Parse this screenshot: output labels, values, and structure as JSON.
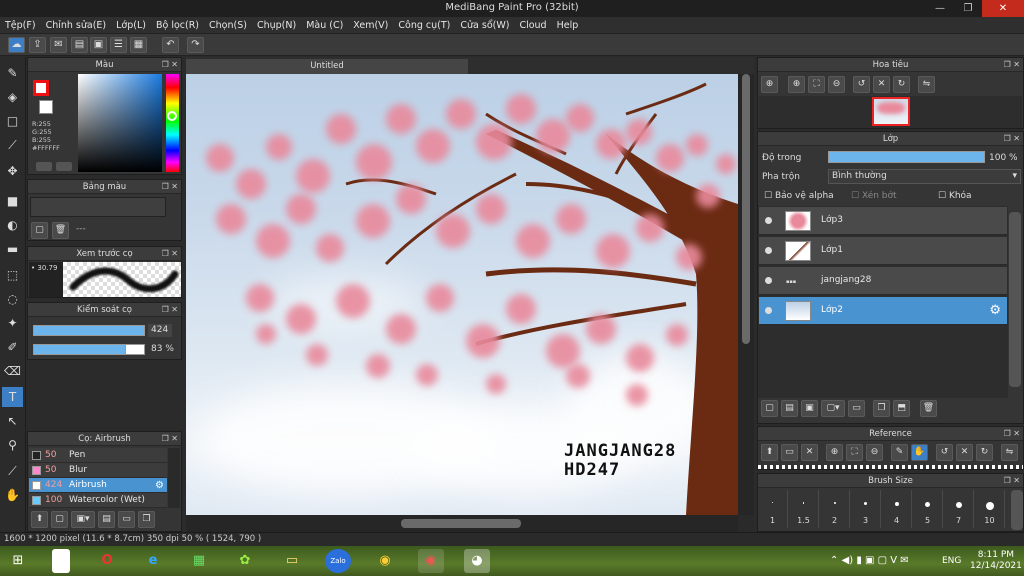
{
  "window": {
    "title": "MediBang Paint Pro (32bit)",
    "minimize": "—",
    "restore": "❐",
    "close": "✕"
  },
  "menu": [
    "Tệp(F)",
    "Chỉnh sửa(E)",
    "Lớp(L)",
    "Bộ lọc(R)",
    "Chọn(S)",
    "Chụp(N)",
    "Màu (C)",
    "Xem(V)",
    "Công cụ(T)",
    "Cửa sổ(W)",
    "Cloud",
    "Help"
  ],
  "panels": {
    "color": {
      "title": "Màu",
      "r": "R:255",
      "g": "G:255",
      "b": "B:255",
      "hex": "#FFFFFF"
    },
    "palette": {
      "title": "Bảng màu",
      "dash": "---"
    },
    "preview": {
      "title": "Xem trước cọ",
      "size": "30.79"
    },
    "control": {
      "title": "Kiểm soát cọ",
      "size": "424",
      "opacity": "83 %",
      "size_fraction": 1.0,
      "opacity_fraction": 0.83
    },
    "brush": {
      "title": "Cọ: Airbrush",
      "items": [
        {
          "size": "50",
          "name": "Pen",
          "color": "#222222"
        },
        {
          "size": "50",
          "name": "Blur",
          "color": "#ff88cc"
        },
        {
          "size": "424",
          "name": "Airbrush",
          "color": "#ffffff",
          "selected": true
        },
        {
          "size": "100",
          "name": "Watercolor (Wet)",
          "color": "#66ccff"
        }
      ]
    },
    "navigator": {
      "title": "Hoa tiêu"
    },
    "layer": {
      "title": "Lớp",
      "opacity_label": "Độ trong",
      "opacity_value": "100 %",
      "blend_label": "Pha trộn",
      "blend_value": "Bình thường",
      "protect_alpha": "Bảo vệ alpha",
      "clipping": "Xén bớt",
      "lock": "Khóa",
      "layers": [
        {
          "name": "Lớp3"
        },
        {
          "name": "Lớp1"
        },
        {
          "name": "jangjang28"
        },
        {
          "name": "Lớp2",
          "selected": true
        }
      ]
    },
    "reference": {
      "title": "Reference"
    },
    "brushsize": {
      "title": "Brush Size",
      "sizes": [
        "1",
        "1.5",
        "2",
        "3",
        "4",
        "5",
        "7",
        "10"
      ]
    }
  },
  "canvas": {
    "tab": "Untitled",
    "signature_line1": "JANGJANG28",
    "signature_line2": "HD247"
  },
  "status": {
    "text": "1600 * 1200 pixel   (11.6 * 8.7cm)   350 dpi   50 %   ( 1524, 790 )"
  },
  "taskbar": {
    "lang": "ENG",
    "time": "8:11 PM",
    "date": "12/14/2021"
  },
  "colors": {
    "accent": "#4a93d1",
    "blossom": "#e98a9c",
    "trunk": "#6b2a12"
  }
}
